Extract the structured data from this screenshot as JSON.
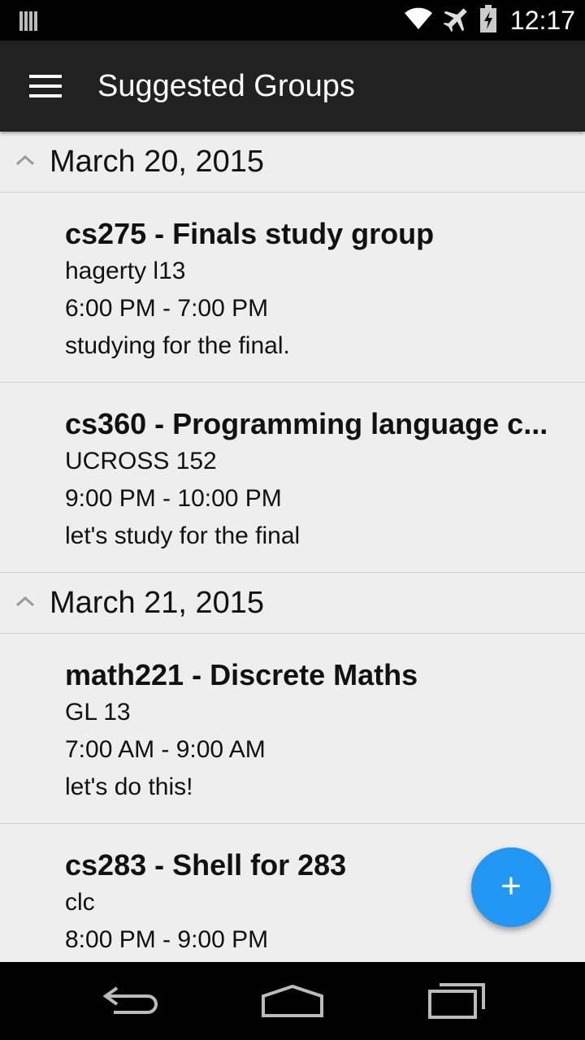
{
  "status_bar": {
    "time": "12:17",
    "icons": [
      "signal-bars-icon",
      "wifi-icon",
      "airplane-mode-icon",
      "battery-icon"
    ]
  },
  "app_bar": {
    "menu_icon": "hamburger-menu-icon",
    "title": "Suggested Groups"
  },
  "sections": [
    {
      "date": "March 20, 2015",
      "expanded": true,
      "groups": [
        {
          "title": "cs275 - Finals study group",
          "location": "hagerty l13",
          "time": "6:00 PM - 7:00 PM",
          "description": "studying for the final."
        },
        {
          "title": "cs360 - Programming language c...",
          "location": "UCROSS 152",
          "time": "9:00 PM - 10:00 PM",
          "description": "let's study for the final"
        }
      ]
    },
    {
      "date": "March 21, 2015",
      "expanded": true,
      "groups": [
        {
          "title": "math221 - Discrete Maths",
          "location": "GL 13",
          "time": "7:00 AM - 9:00 AM",
          "description": "let's do this!"
        },
        {
          "title": "cs283 - Shell for 283",
          "location": "clc",
          "time": "8:00 PM - 9:00 PM",
          "description": ""
        }
      ]
    }
  ],
  "fab": {
    "label": "+",
    "icon": "add-icon",
    "color": "#2196f3"
  },
  "nav_bar": {
    "buttons": [
      "back-icon",
      "home-icon",
      "recent-apps-icon"
    ]
  },
  "colors": {
    "app_bar": "#212121",
    "background": "#eeeeee",
    "accent": "#2196f3"
  }
}
